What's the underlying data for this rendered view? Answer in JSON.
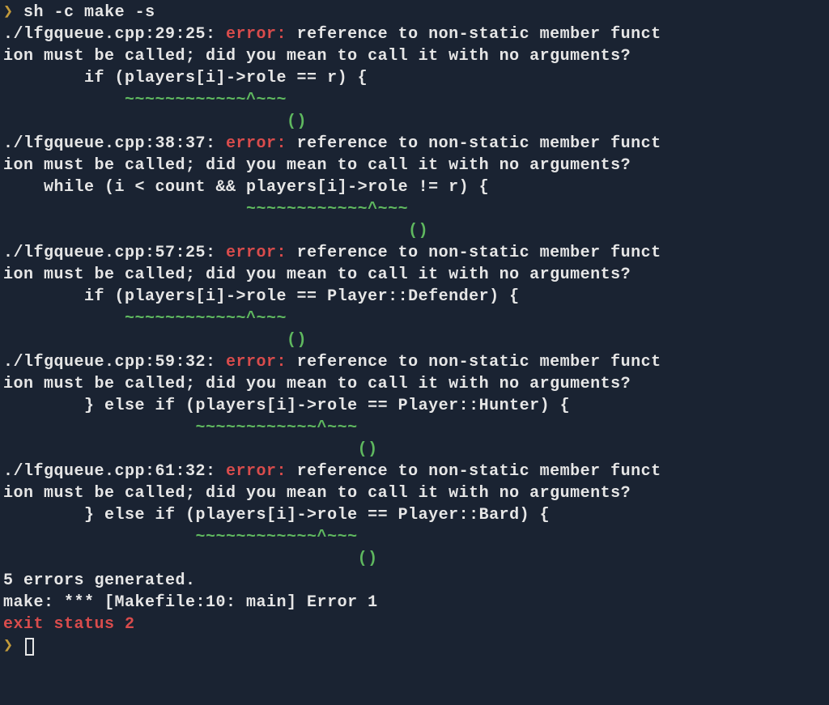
{
  "promptSymbol": "❯",
  "command": " sh -c make -s",
  "errors": [
    {
      "loc": "./lfgqueue.cpp:29:25: ",
      "errLabel": "error:",
      "msg1": " reference to non-static member funct",
      "msg2": "ion must be called; did you mean to call it with no arguments?",
      "code": "        if (players[i]->role == r) {",
      "underline": "            ~~~~~~~~~~~~^~~~",
      "fixit": "                            ()"
    },
    {
      "loc": "./lfgqueue.cpp:38:37: ",
      "errLabel": "error:",
      "msg1": " reference to non-static member funct",
      "msg2": "ion must be called; did you mean to call it with no arguments?",
      "code": "    while (i < count && players[i]->role != r) {",
      "underline": "                        ~~~~~~~~~~~~^~~~",
      "fixit": "                                        ()"
    },
    {
      "loc": "./lfgqueue.cpp:57:25: ",
      "errLabel": "error:",
      "msg1": " reference to non-static member funct",
      "msg2": "ion must be called; did you mean to call it with no arguments?",
      "code": "        if (players[i]->role == Player::Defender) {",
      "underline": "            ~~~~~~~~~~~~^~~~",
      "fixit": "                            ()"
    },
    {
      "loc": "./lfgqueue.cpp:59:32: ",
      "errLabel": "error:",
      "msg1": " reference to non-static member funct",
      "msg2": "ion must be called; did you mean to call it with no arguments?",
      "code": "        } else if (players[i]->role == Player::Hunter) {",
      "underline": "                   ~~~~~~~~~~~~^~~~",
      "fixit": "                                   ()"
    },
    {
      "loc": "./lfgqueue.cpp:61:32: ",
      "errLabel": "error:",
      "msg1": " reference to non-static member funct",
      "msg2": "ion must be called; did you mean to call it with no arguments?",
      "code": "        } else if (players[i]->role == Player::Bard) {",
      "underline": "                   ~~~~~~~~~~~~^~~~",
      "fixit": "                                   ()"
    }
  ],
  "summary": "5 errors generated.",
  "makeError": "make: *** [Makefile:10: main] Error 1",
  "exitStatus": "exit status 2"
}
